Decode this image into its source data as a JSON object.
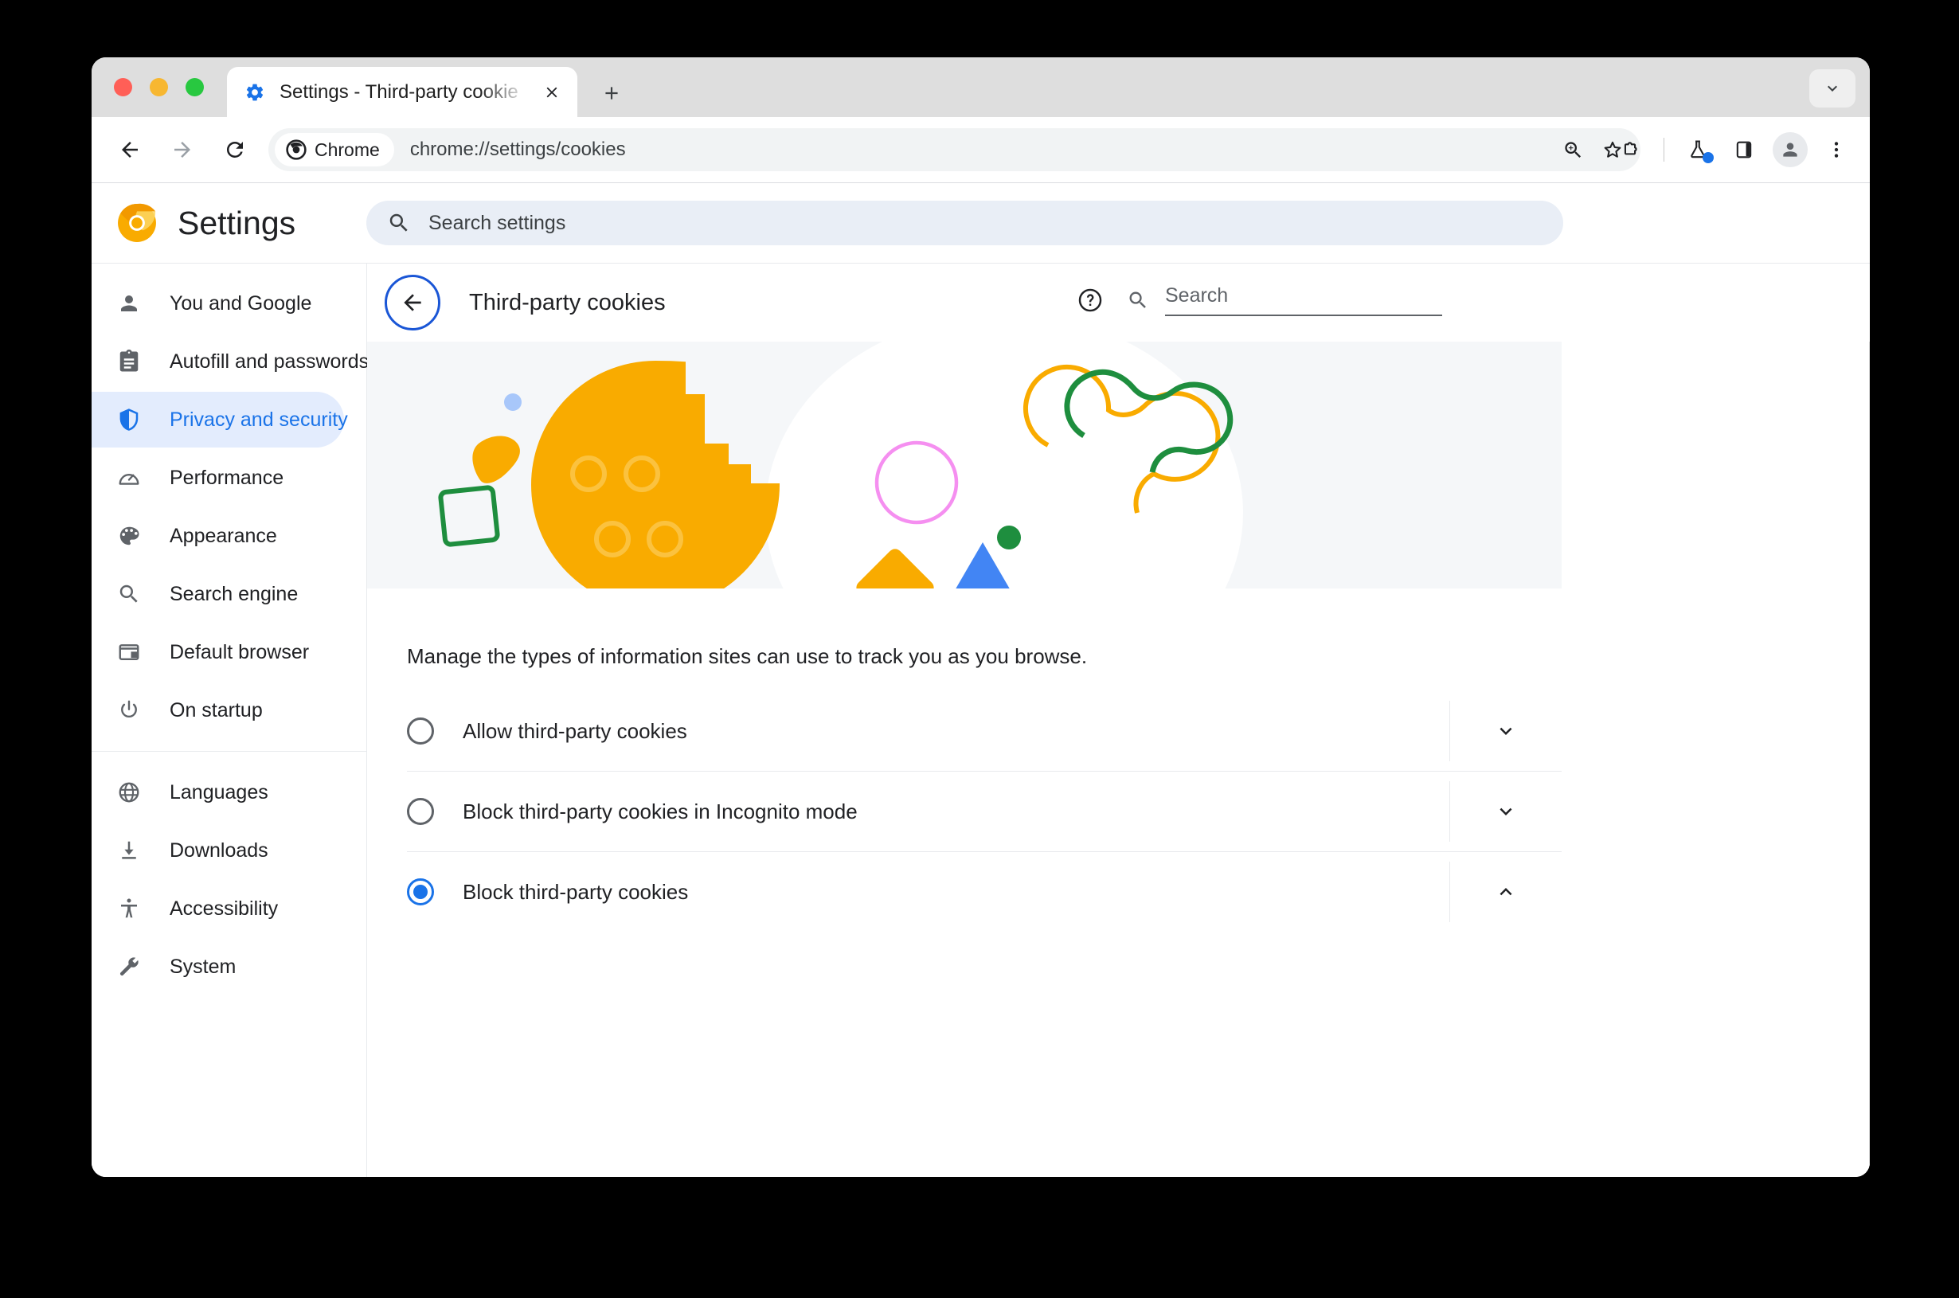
{
  "window": {
    "traffic_lights": [
      "close",
      "minimize",
      "maximize"
    ]
  },
  "tabstrip": {
    "tab": {
      "favicon": "gear-icon",
      "title": "Settings - Third-party cookie",
      "close_label": "Close tab"
    },
    "new_tab_label": "New Tab",
    "tab_search_label": "Search tabs"
  },
  "toolbar": {
    "back_label": "Back",
    "forward_label": "Forward",
    "reload_label": "Reload",
    "chrome_chip_label": "Chrome",
    "url": "chrome://settings/cookies",
    "zoom_label": "Zoom",
    "bookmark_label": "Bookmark this tab",
    "extensions_label": "Extensions",
    "experiments_label": "Experiments",
    "side_panel_label": "Side panel",
    "profile_label": "Profile",
    "menu_label": "Customize and control Google Chrome"
  },
  "settings_header": {
    "title": "Settings",
    "search_placeholder": "Search settings"
  },
  "sidebar": {
    "group_one": [
      {
        "label": "You and Google",
        "icon": "person-icon",
        "active": false
      },
      {
        "label": "Autofill and passwords",
        "icon": "clipboard-icon",
        "active": false
      },
      {
        "label": "Privacy and security",
        "icon": "shield-icon",
        "active": true
      },
      {
        "label": "Performance",
        "icon": "speedometer-icon",
        "active": false
      },
      {
        "label": "Appearance",
        "icon": "palette-icon",
        "active": false
      },
      {
        "label": "Search engine",
        "icon": "search-icon",
        "active": false
      },
      {
        "label": "Default browser",
        "icon": "browser-window-icon",
        "active": false
      },
      {
        "label": "On startup",
        "icon": "power-icon",
        "active": false
      }
    ],
    "group_two": [
      {
        "label": "Languages",
        "icon": "globe-icon",
        "active": false
      },
      {
        "label": "Downloads",
        "icon": "download-icon",
        "active": false
      },
      {
        "label": "Accessibility",
        "icon": "accessibility-icon",
        "active": false
      },
      {
        "label": "System",
        "icon": "wrench-icon",
        "active": false
      }
    ]
  },
  "page": {
    "title": "Third-party cookies",
    "back_label": "Back",
    "help_label": "Help",
    "search_placeholder": "Search",
    "description": "Manage the types of information sites can use to track you as you browse.",
    "options": [
      {
        "label": "Allow third-party cookies",
        "selected": false,
        "expanded": false
      },
      {
        "label": "Block third-party cookies in Incognito mode",
        "selected": false,
        "expanded": false
      },
      {
        "label": "Block third-party cookies",
        "selected": true,
        "expanded": true
      }
    ]
  },
  "colors": {
    "accent_blue": "#1a73e8",
    "cookie_orange": "#f9ab00",
    "green": "#1e8e3e",
    "pink": "#f58ff0",
    "light_blue": "#a8c7fa",
    "banner_bg": "#f5f7f9",
    "active_sidebar_bg": "#e3ecfd"
  }
}
